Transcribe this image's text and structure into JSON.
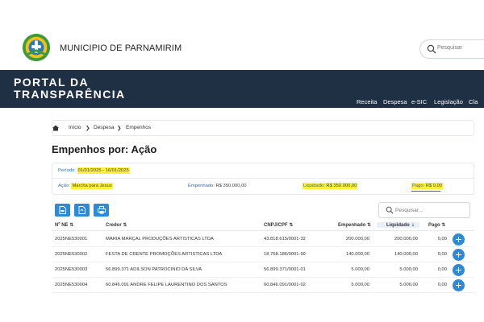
{
  "header": {
    "municipality": "MUNICIPIO DE PARNAMIRIM",
    "search_placeholder": "Pesquisar",
    "logo_icon": "parnamirim-seal-icon"
  },
  "banner": {
    "title_line1": "PORTAL DA",
    "title_line2": "TRANSPARÊNCIA",
    "nav": [
      "Receita",
      "Despesa",
      "e-SIC",
      "Legislação",
      "Cla"
    ],
    "bg_color": "#1f2f44"
  },
  "breadcrumb": {
    "items": [
      "Início",
      "Despesa",
      "Empenhos"
    ]
  },
  "page_title": "Empenhos por: Ação",
  "filters": {
    "periodo_label": "Período:",
    "periodo_value": "01/01/2025 - 16/01/2025",
    "acao_label": "Ação:",
    "acao_value": "Marcha para Jesus",
    "empenhado_label": "Empenhado:",
    "empenhado_value": "R$ 350.000,00",
    "liquidado_label": "Liquidado:",
    "liquidado_value": "R$ 350.000,00",
    "pago_label": "Pago:",
    "pago_value": "R$ 0,00",
    "highlight_color": "#fff13a"
  },
  "toolbar": {
    "buttons": [
      "pdf-export-icon",
      "pdf-export-icon",
      "print-icon"
    ],
    "search_placeholder": "Pesquisar..."
  },
  "table": {
    "columns": [
      "Nº NE",
      "Credor",
      "CNPJ/CPF",
      "Empenhado",
      "Liquidado",
      "Pago"
    ],
    "rows": [
      [
        "2025NE530001",
        "MARIA MARÇAL PRODUÇÕES ARTISTICAS LTDA",
        "43.818.615/0001-32",
        "200.000,00",
        "200.000,00",
        "0,00"
      ],
      [
        "2025NE530002",
        "FESTA DE CRENTE PROMOÇÕES ARTISTICAS LTDA",
        "18.768.186/0001-99",
        "140.000,00",
        "140.000,00",
        "0,00"
      ],
      [
        "2025NE530003",
        "56.899.371 ADILSON PATROCINIO DA SILVA",
        "56.899.371/0001-01",
        "5.000,00",
        "5.000,00",
        "0,00"
      ],
      [
        "2025NE530004",
        "60.846.091 ANDRE FELIPE LAURENTINO DOS SANTOS",
        "60.846.091/0001-02",
        "5.000,00",
        "5.000,00",
        "0,00"
      ]
    ]
  }
}
